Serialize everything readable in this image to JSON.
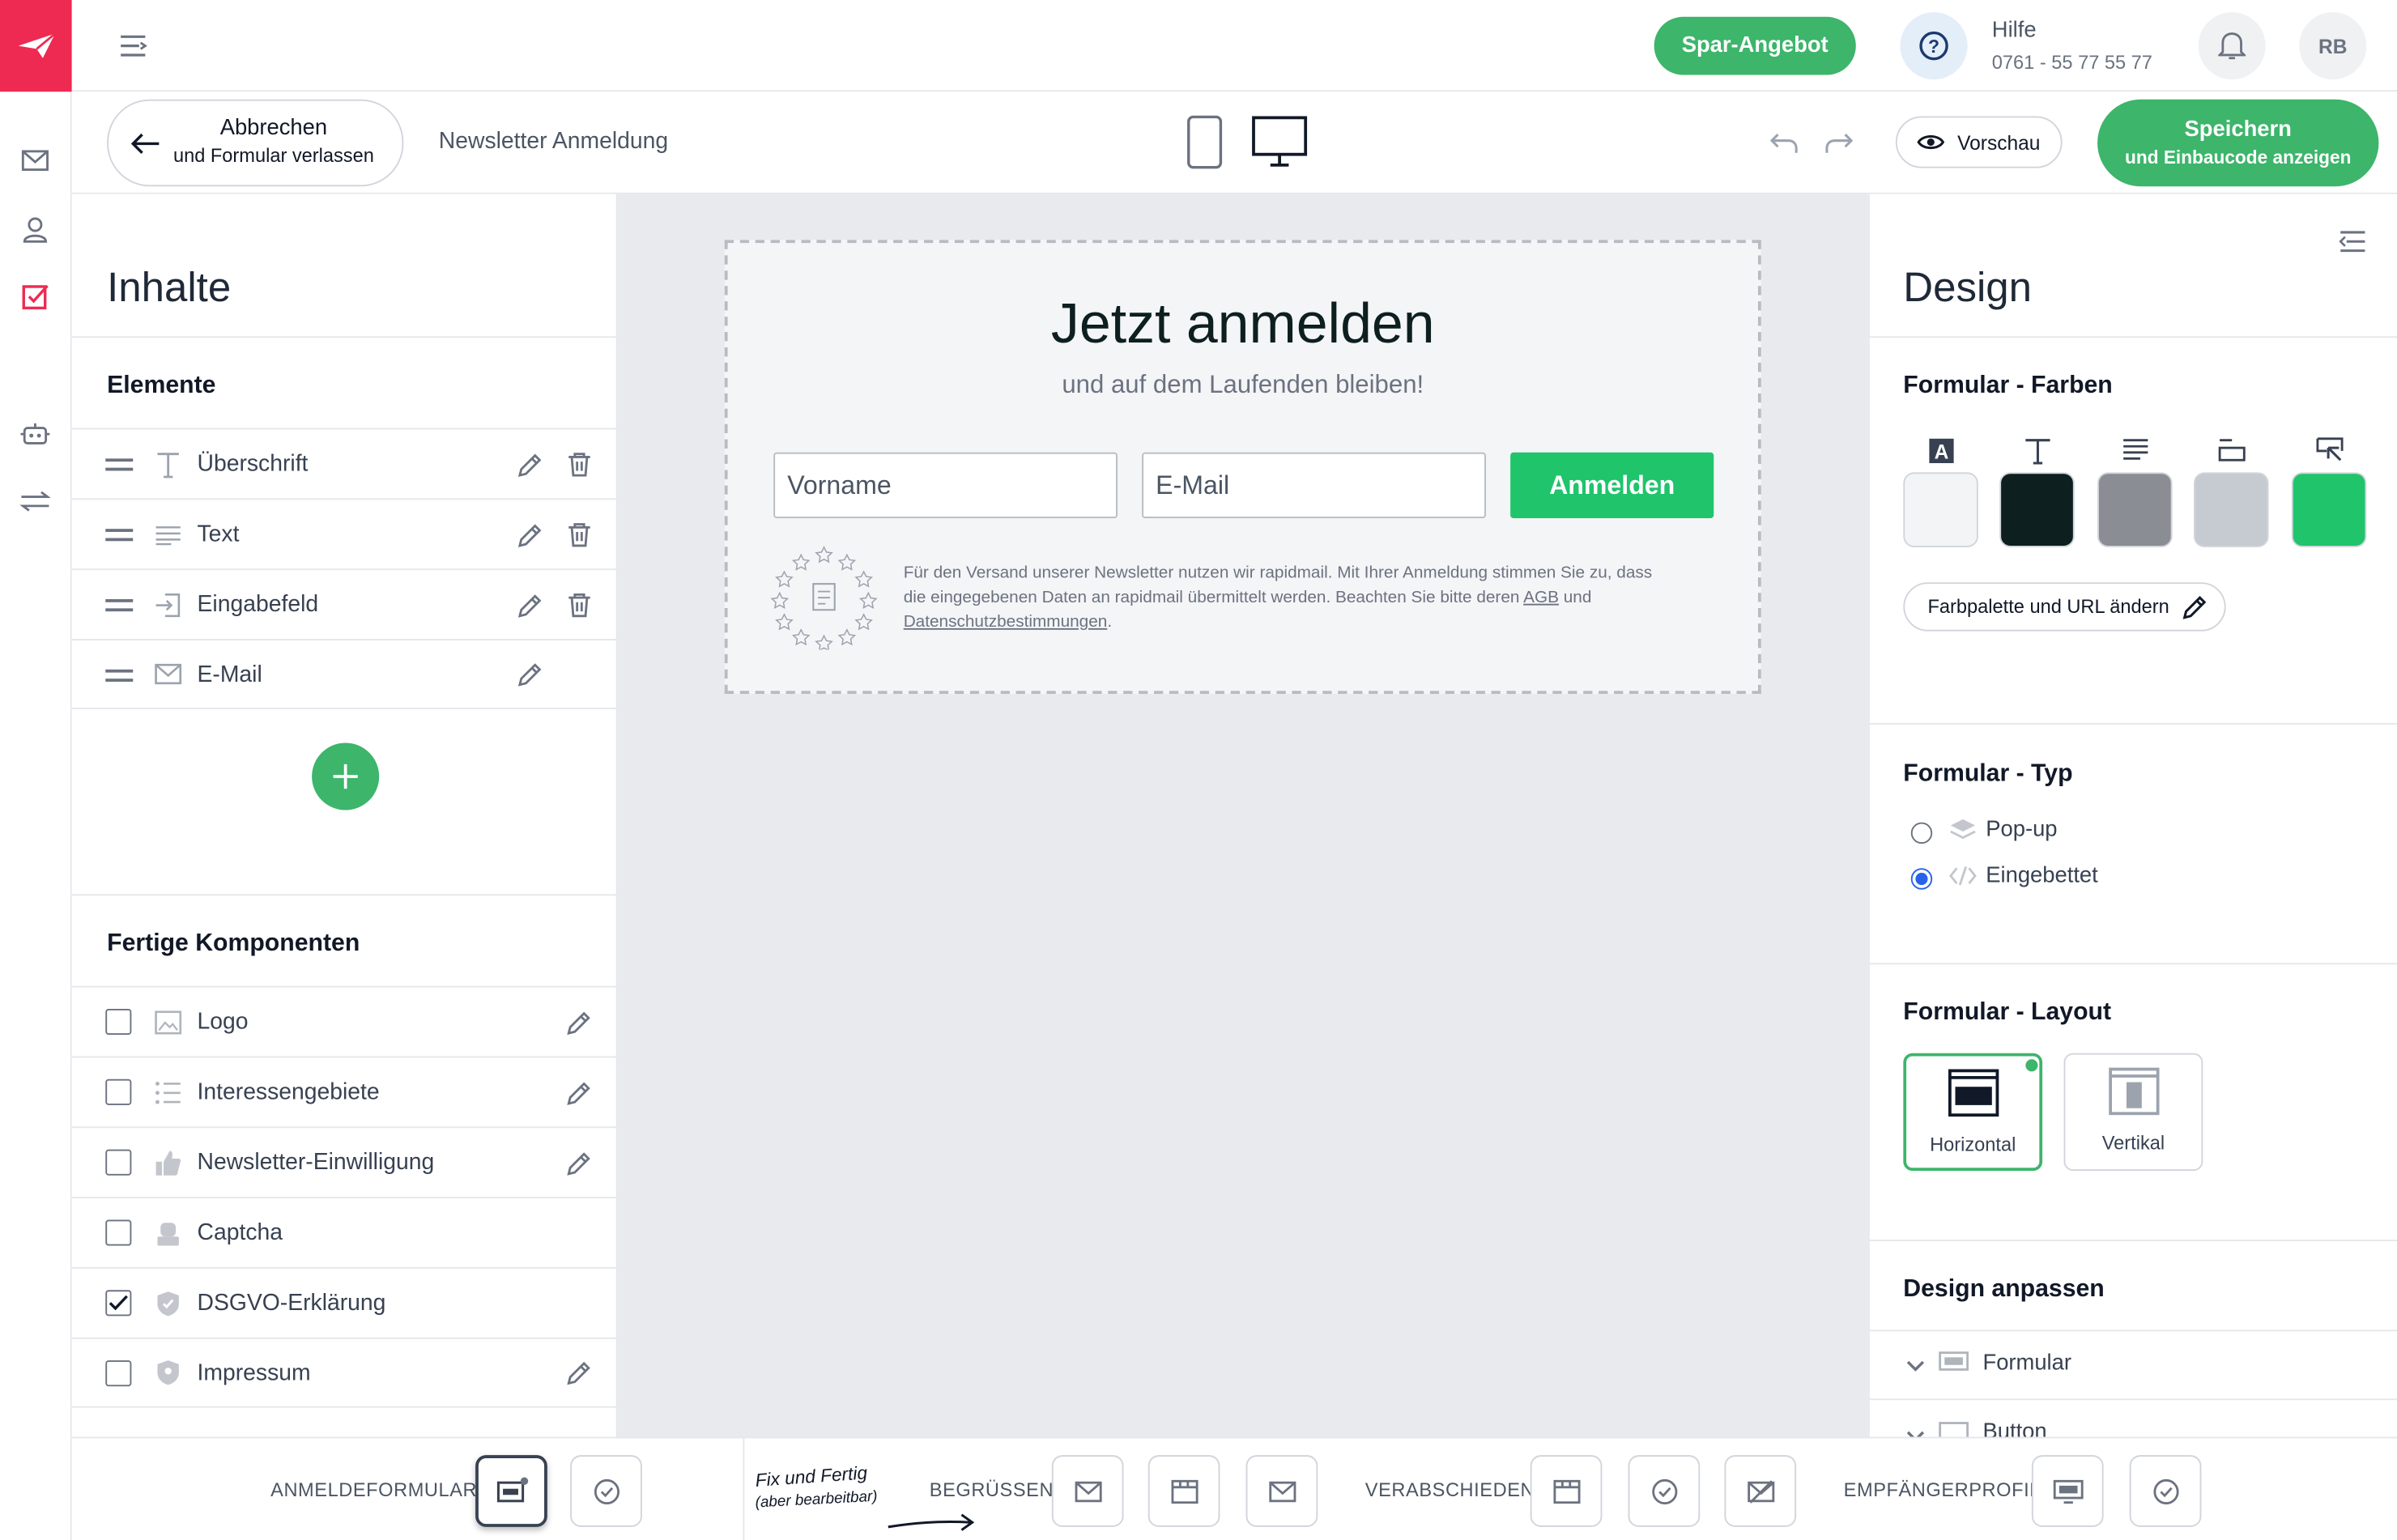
{
  "colors": {
    "brand": "#ee2a52",
    "accent": "#3db56b",
    "form_green": "#1fc46b"
  },
  "topbar": {
    "promo": "Spar-Angebot",
    "help_title": "Hilfe",
    "help_phone": "0761 - 55 77 55 77",
    "avatar": "RB"
  },
  "editorbar": {
    "cancel_line1": "Abbrechen",
    "cancel_line2": "und Formular verlassen",
    "form_name": "Newsletter Anmeldung",
    "preview": "Vorschau",
    "save_line1": "Speichern",
    "save_line2": "und Einbaucode anzeigen"
  },
  "left": {
    "title": "Inhalte",
    "elements_heading": "Elemente",
    "elements": [
      {
        "label": "Überschrift",
        "icon": "heading-icon"
      },
      {
        "label": "Text",
        "icon": "text-lines-icon"
      },
      {
        "label": "Eingabefeld",
        "icon": "input-field-icon"
      },
      {
        "label": "E-Mail",
        "icon": "envelope-icon"
      }
    ],
    "components_heading": "Fertige Komponenten",
    "components": [
      {
        "label": "Logo",
        "checked": false
      },
      {
        "label": "Interessengebiete",
        "checked": false
      },
      {
        "label": "Newsletter-Einwilligung",
        "checked": false
      },
      {
        "label": "Captcha",
        "checked": false
      },
      {
        "label": "DSGVO-Erklärung",
        "checked": true
      },
      {
        "label": "Impressum",
        "checked": false
      }
    ]
  },
  "form": {
    "title": "Jetzt anmelden",
    "subtitle": "und auf dem Laufenden bleiben!",
    "firstname_placeholder": "Vorname",
    "email_placeholder": "E-Mail",
    "submit": "Anmelden",
    "gdpr_1": "Für den Versand unserer Newsletter nutzen wir rapidmail. Mit Ihrer Anmeldung stimmen Sie zu, dass",
    "gdpr_2": "die eingegebenen Daten an rapidmail übermittelt werden. Beachten Sie bitte deren",
    "gdpr_agb": "AGB",
    "gdpr_und": "und",
    "gdpr_privacy": "Datenschutzbestimmungen",
    "gdpr_dot": "."
  },
  "right": {
    "title": "Design",
    "colors_heading": "Formular - Farben",
    "swatches": [
      "#f3f4f6",
      "#0d1f1f",
      "#8a8e94",
      "#c6cbd1",
      "#1fc46b"
    ],
    "palette_button": "Farbpalette und URL ändern",
    "type_heading": "Formular - Typ",
    "type_popup": "Pop-up",
    "type_embedded": "Eingebettet",
    "type_selected": "Eingebettet",
    "layout_heading": "Formular - Layout",
    "layout_horizontal": "Horizontal",
    "layout_vertical": "Vertikal",
    "layout_selected": "Horizontal",
    "customize_heading": "Design anpassen",
    "customize_form": "Formular",
    "customize_button": "Button"
  },
  "bottom": {
    "step1": "ANMELDEFORMULAR",
    "note1": "Fix und Fertig",
    "note2": "(aber bearbeitbar)",
    "step2": "BEGRÜSSEN",
    "step3": "VERABSCHIEDEN",
    "step4": "EMPFÄNGERPROFIL"
  }
}
